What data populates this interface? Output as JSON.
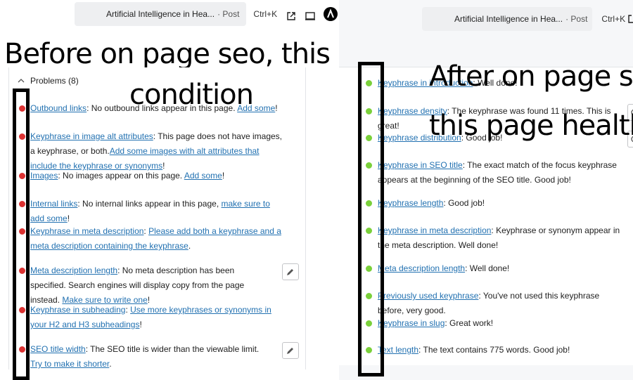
{
  "left": {
    "command": {
      "title": "Artificial Intelligence in Hea...",
      "type": "· Post",
      "shortcut": "Ctrl+K"
    },
    "annotation_line1": "Before on page seo, this page",
    "annotation_line2": "condition",
    "problems_label": "Problems (8)",
    "items": [
      {
        "link": "Outbound links",
        "text": ": No outbound links appear in this page. ",
        "link2": "Add some",
        "tail": "!"
      },
      {
        "link": "Keyphrase in image alt attributes",
        "text": ": This page does not have images, a keyphrase, or both.",
        "link2": "Add some images with alt attributes that include the keyphrase or synonyms",
        "tail": "!"
      },
      {
        "link": "Images",
        "text": ": No images appear on this page. ",
        "link2": "Add some",
        "tail": "!"
      },
      {
        "link": "Internal links",
        "text": ": No internal links appear in this page, ",
        "link2": "make sure to add some",
        "tail": "!"
      },
      {
        "link": "Keyphrase in meta description",
        "text": ": ",
        "link2": "Please add both a keyphrase and a meta description containing the keyphrase",
        "tail": "."
      },
      {
        "link": "Meta description length",
        "text": ": No meta description has been specified. Search engines will display copy from the page instead. ",
        "link2": "Make sure to write one",
        "tail": "!"
      },
      {
        "link": "Keyphrase in subheading",
        "text": ": ",
        "link2": "Use more keyphrases or synonyms in your H2 and H3 subheadings",
        "tail": "!"
      },
      {
        "link": "SEO title width",
        "text": ": The SEO title is wider than the viewable limit. ",
        "link2": "Try to make it shorter",
        "tail": "."
      }
    ]
  },
  "right": {
    "command": {
      "title": "Artificial Intelligence in Hea...",
      "type": "· Post",
      "shortcut": "Ctrl+K"
    },
    "annotation_line1": "After on page seo",
    "annotation_line2": "this page health",
    "items": [
      {
        "link": "Keyphrase in introduction",
        "text": ": Well done!"
      },
      {
        "link": "Keyphrase density",
        "text": ": The keyphrase was found 11 times. This is great!"
      },
      {
        "link": "Keyphrase distribution",
        "text": ": Good job!"
      },
      {
        "link": "Keyphrase in SEO title",
        "text": ": The exact match of the focus keyphrase appears at the beginning of the SEO title. Good job!"
      },
      {
        "link": "Keyphrase length",
        "text": ": Good job!"
      },
      {
        "link": "Keyphrase in meta description",
        "text": ": Keyphrase or synonym appear in the meta description. Well done!"
      },
      {
        "link": "Meta description length",
        "text": ": Well done!"
      },
      {
        "link": "Previously used keyphrase",
        "text": ": You've not used this keyphrase before, very good."
      },
      {
        "link": "Keyphrase in slug",
        "text": ": Great work!"
      },
      {
        "link": "Text length",
        "text": ": The text contains 775 words. Good job!"
      }
    ]
  },
  "colors": {
    "problem": "#dc3232",
    "good": "#7ad03a",
    "link": "#2271b1"
  },
  "icons": [
    "external-link-icon",
    "preview-icon",
    "astra-logo-icon",
    "menu-icon",
    "chevron-up-icon",
    "pencil-icon",
    "eye-icon"
  ]
}
